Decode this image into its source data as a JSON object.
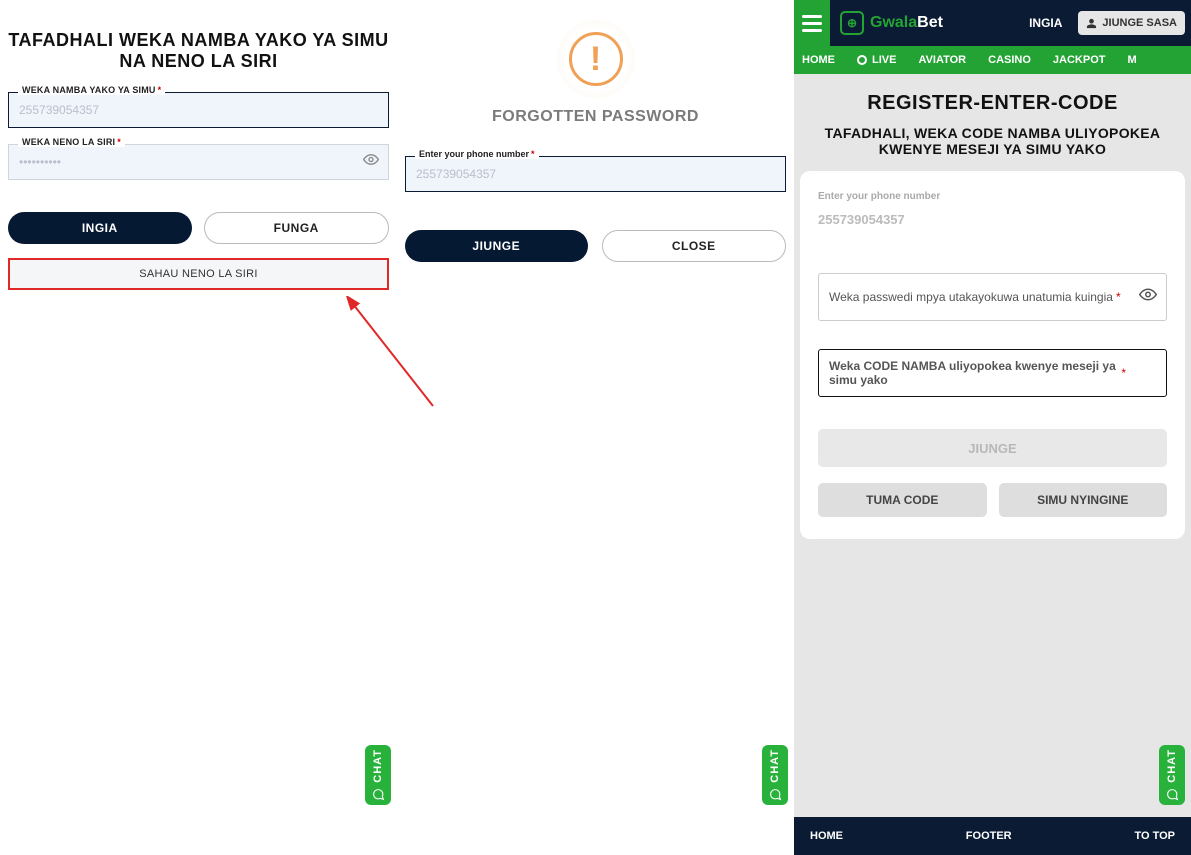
{
  "panel1": {
    "title": "TAFADHALI WEKA NAMBA YAKO YA SIMU NA NENO LA SIRI",
    "phone_label": "WEKA NAMBA YAKO YA SIMU",
    "phone_value": "255739054357",
    "password_label": "WEKA NENO LA SIRI",
    "password_mask": "••••••••••",
    "login_btn": "INGIA",
    "close_btn": "FUNGA",
    "forgot_btn": "SAHAU NENO LA SIRI"
  },
  "panel2": {
    "title": "FORGOTTEN PASSWORD",
    "phone_label": "Enter your phone number",
    "phone_value": "255739054357",
    "join_btn": "JIUNGE",
    "close_btn": "CLOSE"
  },
  "panel3": {
    "header": {
      "brand_gwala": "Gwala",
      "brand_bet": "Bet",
      "ingia": "INGIA",
      "jiunge": "JIUNGE SASA"
    },
    "nav": {
      "home": "HOME",
      "live": "LIVE",
      "aviator": "AVIATOR",
      "casino": "CASINO",
      "jackpot": "JACKPOT",
      "more": "M"
    },
    "reg_title": "REGISTER-ENTER-CODE",
    "subtitle": "TAFADHALI, WEKA CODE NAMBA ULIYOPOKEA KWENYE MESEJI YA SIMU YAKO",
    "phone_label": "Enter your phone number",
    "phone_value": "255739054357",
    "password_placeholder": "Weka passwedi mpya utakayokuwa unatumia kuingia",
    "code_placeholder": "Weka CODE NAMBA uliyopokea kwenye meseji ya simu yako",
    "jiunge_btn": "JIUNGE",
    "tuma_btn": "TUMA CODE",
    "simu_btn": "SIMU NYINGINE",
    "footer": {
      "home": "HOME",
      "footer": "FOOTER",
      "to_top": "TO TOP"
    }
  },
  "chat": {
    "label": "CHAT"
  }
}
